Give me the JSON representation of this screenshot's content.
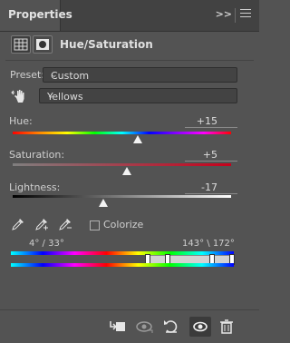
{
  "panel": {
    "tab_title": "Properties",
    "collapse_icon": "double-chevron-right",
    "menu_icon": "hamburger-menu"
  },
  "header": {
    "title": "Hue/Saturation",
    "icons": [
      "adjustment-layer-icon",
      "mask-icon"
    ]
  },
  "preset": {
    "label": "Preset:",
    "value": "Custom"
  },
  "channel": {
    "value": "Yellows",
    "tool_icon": "targeted-adjustment-hand-icon"
  },
  "sliders": {
    "hue": {
      "label": "Hue:",
      "value": "+15",
      "min": -180,
      "max": 180,
      "current": 15
    },
    "saturation": {
      "label": "Saturation:",
      "value": "+5",
      "min": -100,
      "max": 100,
      "current": 5
    },
    "lightness": {
      "label": "Lightness:",
      "value": "-17",
      "min": -100,
      "max": 100,
      "current": -17
    }
  },
  "tools": {
    "colorize_label": "Colorize",
    "colorize_checked": false,
    "droppers": [
      "eyedropper-icon",
      "eyedropper-plus-icon",
      "eyedropper-minus-icon"
    ]
  },
  "range": {
    "left_readout": "4° / 33°",
    "right_readout": "143° \\ 172°"
  },
  "toolbar": {
    "buttons": [
      "clip-to-layer-icon",
      "view-previous-icon",
      "reset-icon",
      "toggle-visibility-icon",
      "delete-icon"
    ],
    "active": "toggle-visibility-icon"
  }
}
